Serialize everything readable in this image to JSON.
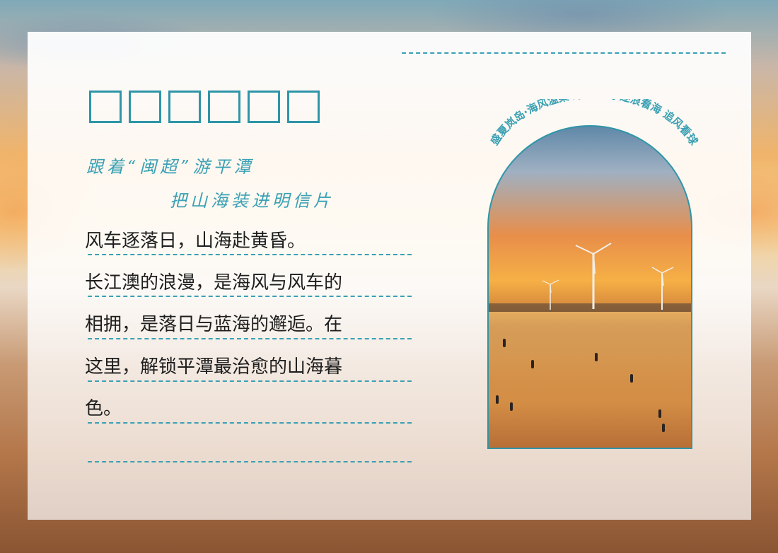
{
  "colors": {
    "accent": "#3aa0b3",
    "body_text": "#1e1e1e",
    "card": "#ffffff"
  },
  "title_placeholder_boxes": 6,
  "subtitle_line1": "跟着“闽超”游平潭",
  "subtitle_line2": "把山海装进明信片",
  "body_lines": [
    "风车逐落日，山海赴黄昏。",
    "长江澳的浪漫，是海风与风车的",
    "相拥，是落日与蓝海的邂逅。在",
    "这里，解锁平潭最治愈的山海暮",
    "色。"
  ],
  "arch_caption": "盛夏岚岛·海风温柔 绿茵滚烫·逐浪看海 追风看球",
  "photo_subject": "wind-turbines-at-sunset-beach"
}
